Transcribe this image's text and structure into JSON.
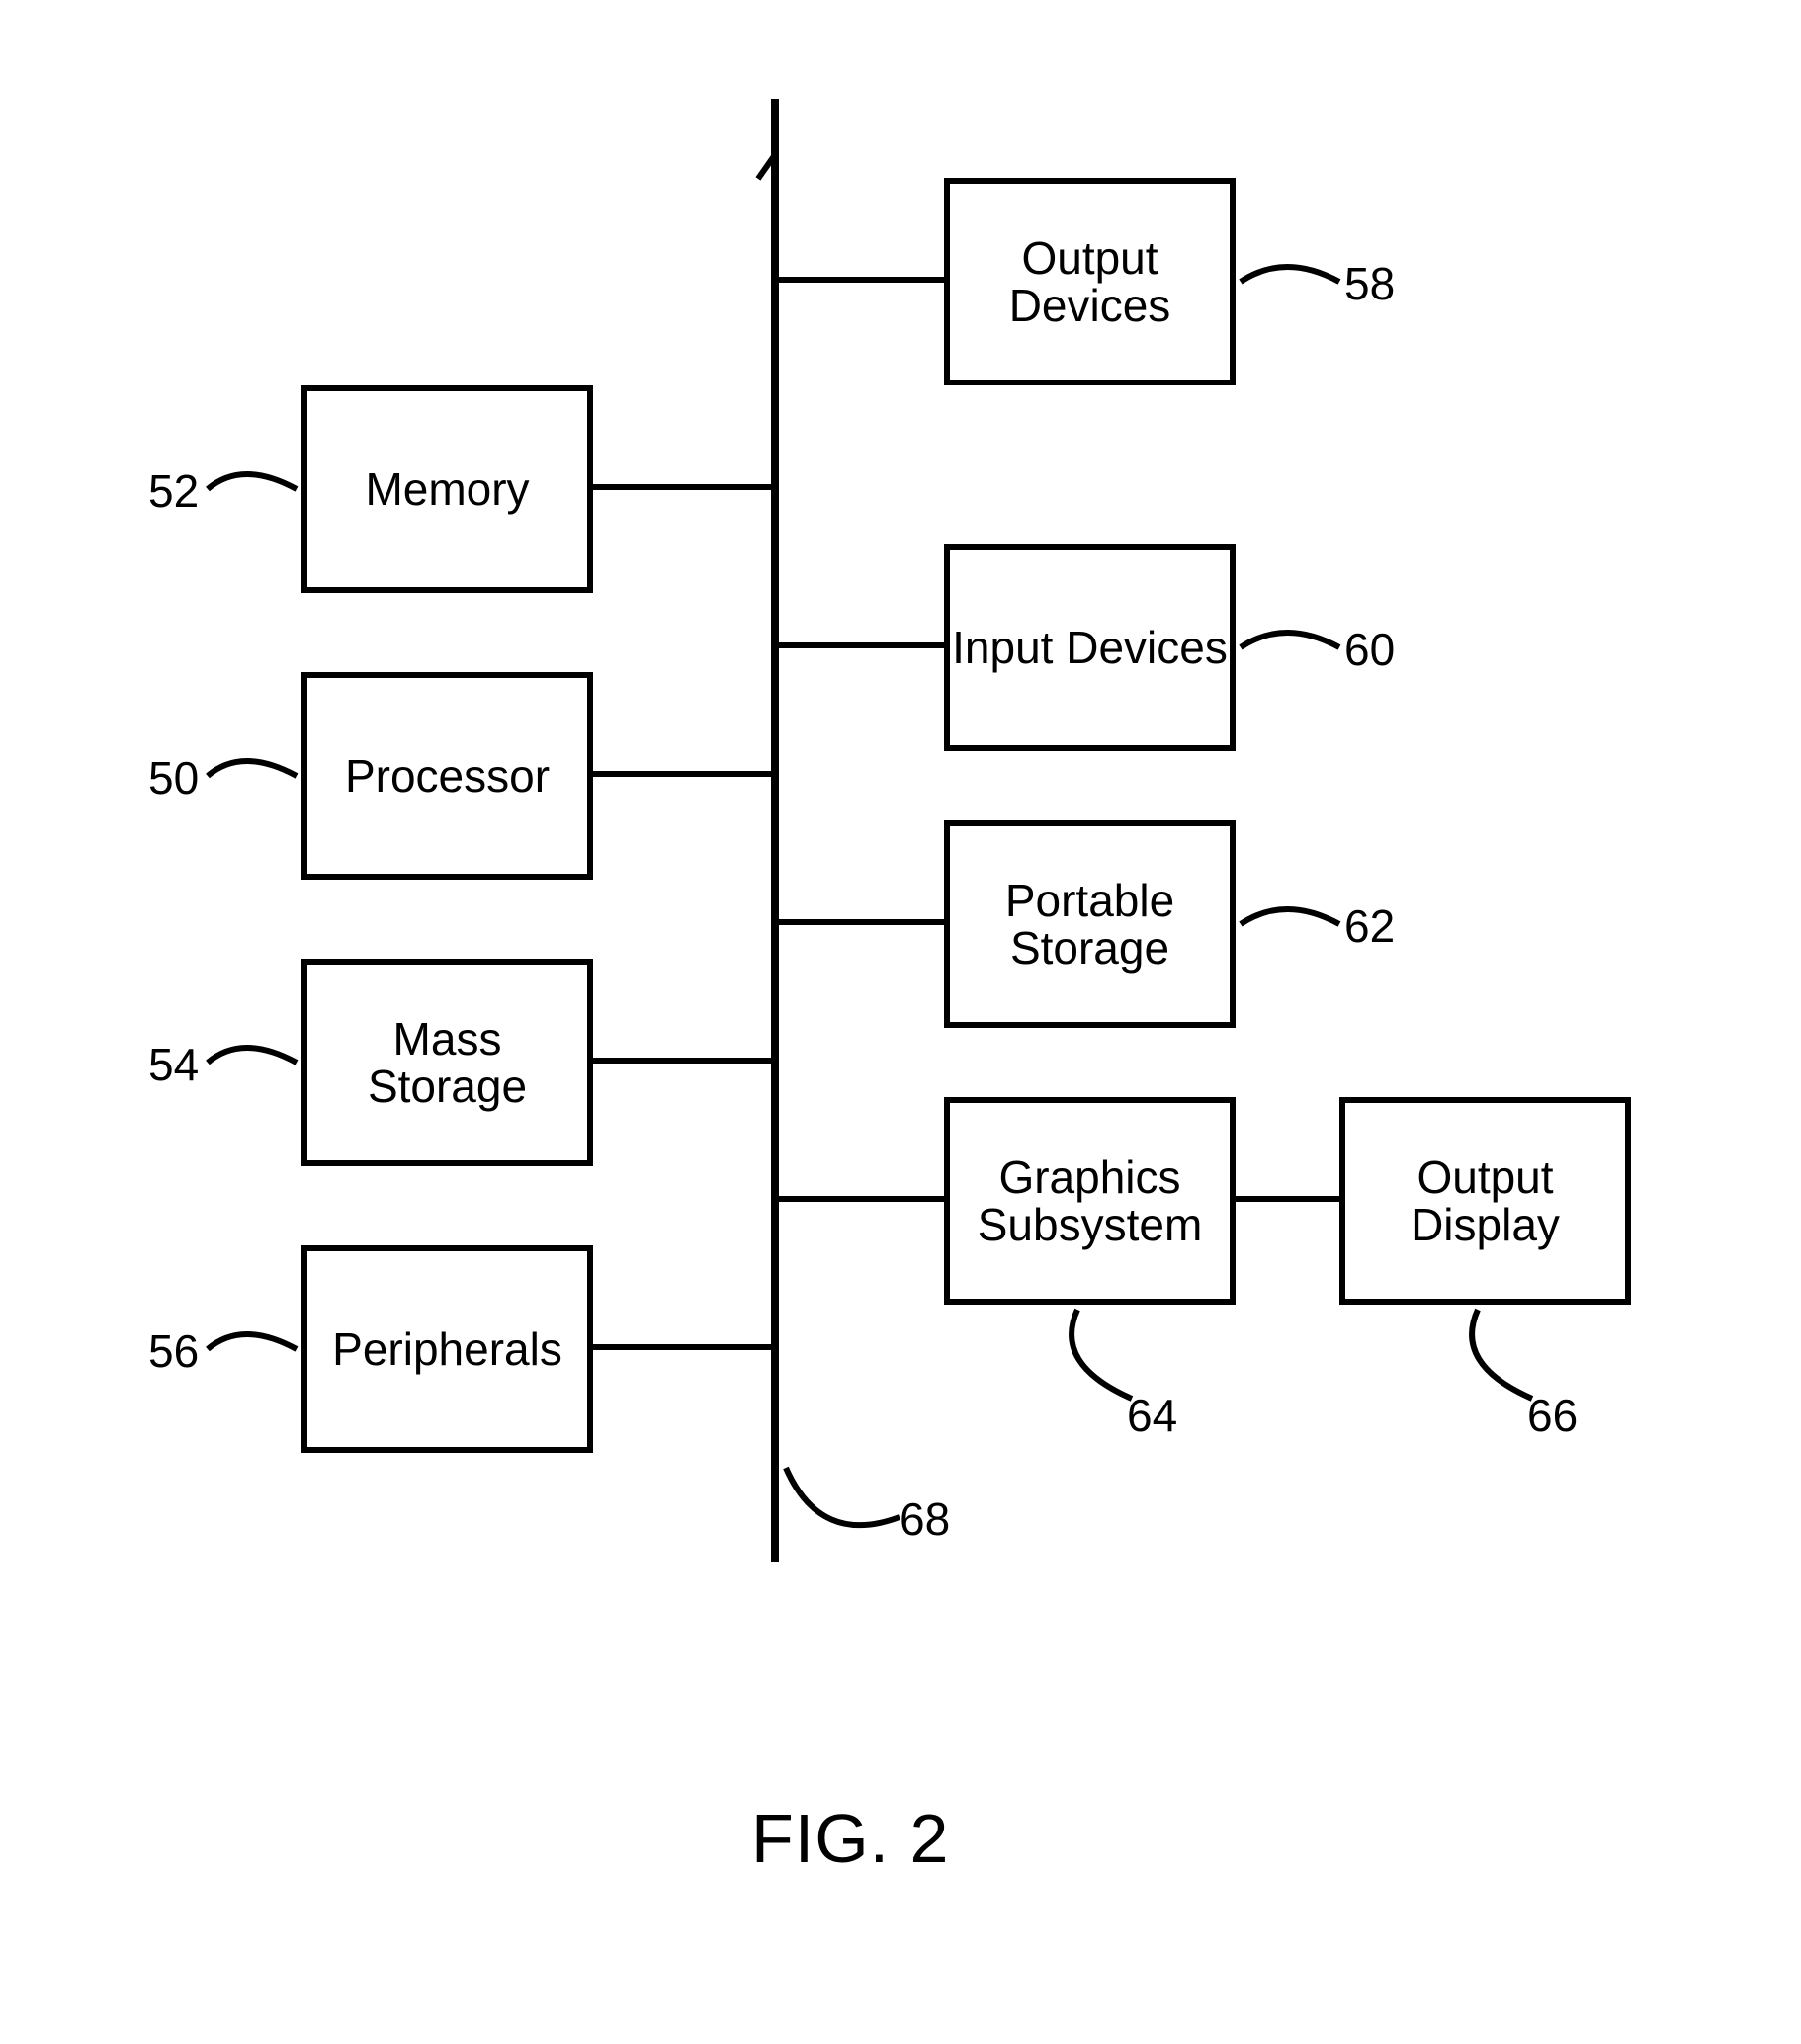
{
  "figure_label": "FIG. 2",
  "bus": {
    "ref": "68"
  },
  "blocks": {
    "memory": {
      "lines": [
        "Memory"
      ],
      "ref": "52"
    },
    "processor": {
      "lines": [
        "Processor"
      ],
      "ref": "50"
    },
    "mass_storage": {
      "lines": [
        "Mass",
        "Storage"
      ],
      "ref": "54"
    },
    "peripherals": {
      "lines": [
        "Peripherals"
      ],
      "ref": "56"
    },
    "output_devices": {
      "lines": [
        "Output",
        "Devices"
      ],
      "ref": "58"
    },
    "input_devices": {
      "lines": [
        "Input Devices"
      ],
      "ref": "60"
    },
    "portable_storage": {
      "lines": [
        "Portable",
        "Storage"
      ],
      "ref": "62"
    },
    "graphics_subsystem": {
      "lines": [
        "Graphics",
        "Subsystem"
      ],
      "ref": "64"
    },
    "output_display": {
      "lines": [
        "Output",
        "Display"
      ],
      "ref": "66"
    }
  }
}
